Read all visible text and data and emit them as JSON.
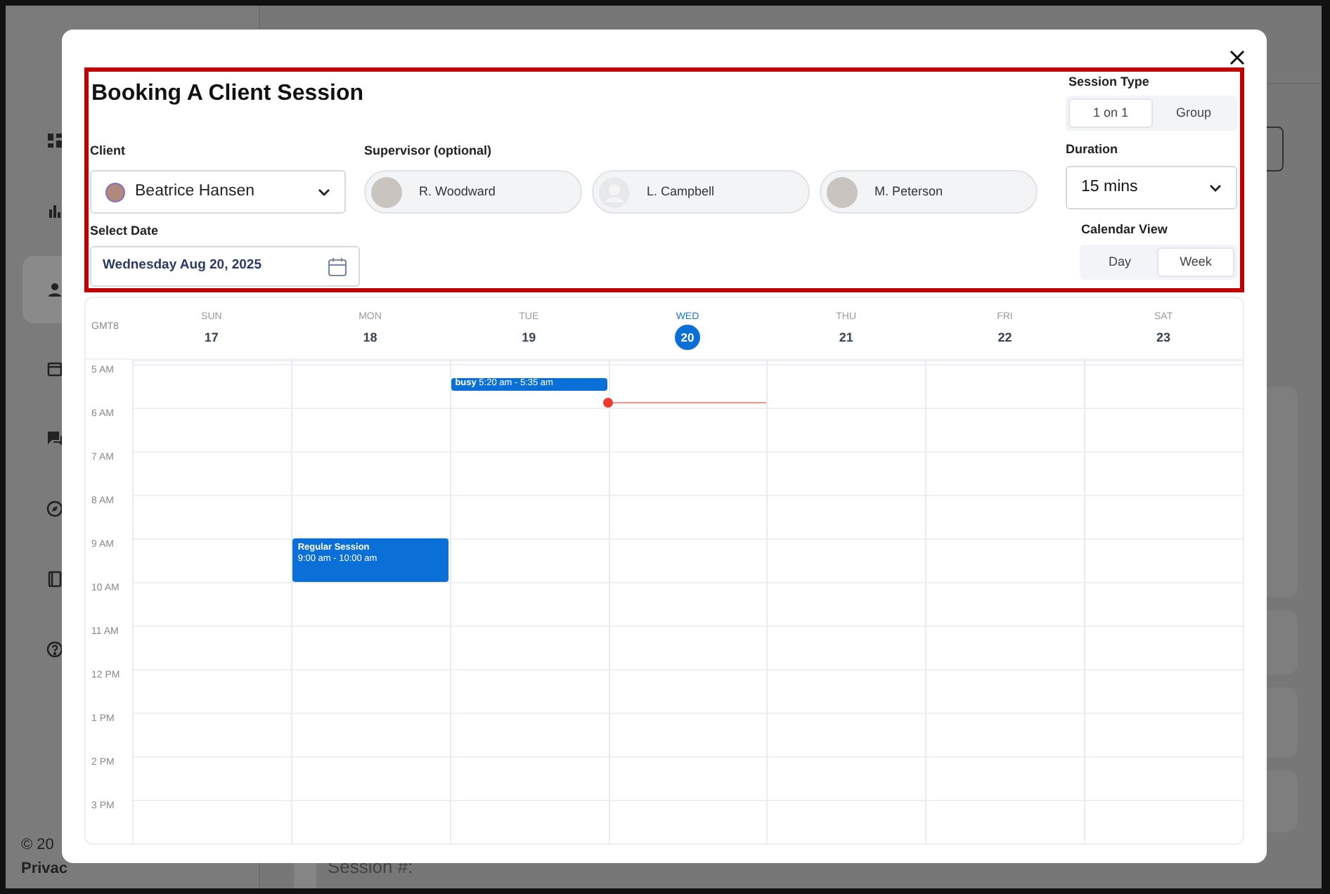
{
  "background": {
    "copyright": "© 20",
    "footer_link": "Privac",
    "session_label": "Session #:"
  },
  "dialog": {
    "title": "Booking A Client Session",
    "client": {
      "label": "Client",
      "value": "Beatrice Hansen"
    },
    "supervisor": {
      "label": "Supervisor (optional)",
      "options": [
        {
          "name": "R. Woodward",
          "kind": "photo"
        },
        {
          "name": "L. Campbell",
          "kind": "silhouette"
        },
        {
          "name": "M. Peterson",
          "kind": "photo"
        }
      ]
    },
    "date": {
      "label": "Select Date",
      "value": "Wednesday Aug 20, 2025"
    },
    "session_type": {
      "label": "Session Type",
      "options": [
        {
          "label": "1 on 1",
          "selected": true
        },
        {
          "label": "Group",
          "selected": false
        }
      ]
    },
    "duration": {
      "label": "Duration",
      "value": "15 mins"
    },
    "calendar_view": {
      "label": "Calendar View",
      "options": [
        {
          "label": "Day",
          "selected": false
        },
        {
          "label": "Week",
          "selected": true
        }
      ]
    },
    "calendar": {
      "timezone": "GMT8",
      "days": [
        {
          "weekday": "SUN",
          "date": "17",
          "today": false
        },
        {
          "weekday": "MON",
          "date": "18",
          "today": false,
          "events": [
            {
              "kind": "session",
              "title": "Regular Session",
              "time": "9:00 am - 10:00 am"
            }
          ]
        },
        {
          "weekday": "TUE",
          "date": "19",
          "today": false,
          "events": [
            {
              "kind": "busy",
              "title": "busy",
              "time": "5:20 am - 5:35 am"
            }
          ]
        },
        {
          "weekday": "WED",
          "date": "20",
          "today": true
        },
        {
          "weekday": "THU",
          "date": "21",
          "today": false
        },
        {
          "weekday": "FRI",
          "date": "22",
          "today": false
        },
        {
          "weekday": "SAT",
          "date": "23",
          "today": false
        }
      ],
      "hours": [
        "5 AM",
        "6 AM",
        "7 AM",
        "8 AM",
        "9 AM",
        "10 AM",
        "11 AM",
        "12 PM",
        "1 PM",
        "2 PM",
        "3 PM"
      ]
    }
  }
}
